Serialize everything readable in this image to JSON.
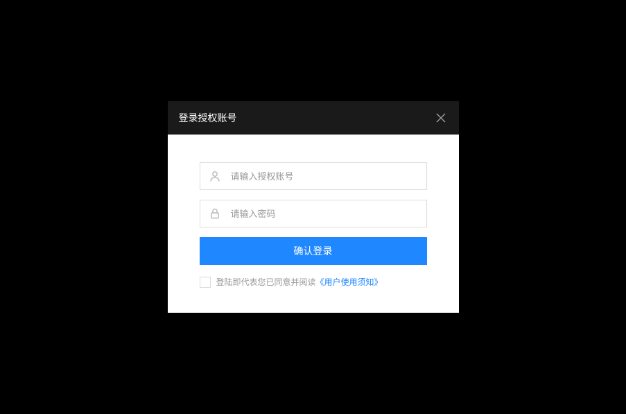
{
  "dialog": {
    "title": "登录授权账号",
    "username": {
      "placeholder": "请输入授权账号",
      "value": ""
    },
    "password": {
      "placeholder": "请输入密码",
      "value": ""
    },
    "submit_label": "确认登录",
    "agreement": {
      "text": "登陆即代表您已同意并阅读",
      "link_text": "《用户使用须知》"
    }
  }
}
